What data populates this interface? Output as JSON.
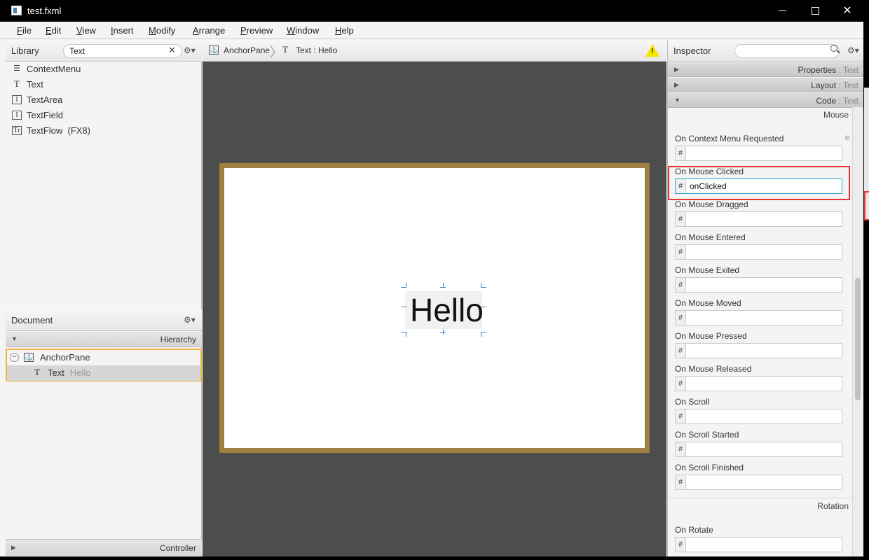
{
  "window": {
    "title": "test.fxml"
  },
  "menu": [
    {
      "label": "File",
      "u": "F",
      "rest": "ile"
    },
    {
      "label": "Edit",
      "u": "E",
      "rest": "dit"
    },
    {
      "label": "View",
      "u": "V",
      "rest": "iew"
    },
    {
      "label": "Insert",
      "u": "I",
      "rest": "nsert"
    },
    {
      "label": "Modify",
      "u": "M",
      "rest": "odify"
    },
    {
      "label": "Arrange",
      "u": "A",
      "rest": "rrange"
    },
    {
      "label": "Preview",
      "u": "P",
      "rest": "review"
    },
    {
      "label": "Window",
      "u": "W",
      "rest": "indow"
    },
    {
      "label": "Help",
      "u": "H",
      "rest": "elp"
    }
  ],
  "library": {
    "title": "Library",
    "search_value": "Text",
    "items": [
      {
        "label": "ContextMenu",
        "icon": "context-menu-icon"
      },
      {
        "label": "Text",
        "icon": "text-icon"
      },
      {
        "label": "TextArea",
        "icon": "textarea-icon"
      },
      {
        "label": "TextField",
        "icon": "textfield-icon"
      },
      {
        "label": "TextFlow  (FX8)",
        "icon": "textflow-icon"
      }
    ]
  },
  "document": {
    "title": "Document",
    "hierarchy_label": "Hierarchy",
    "tree": [
      {
        "label": "AnchorPane",
        "hint": ""
      },
      {
        "label": "Text",
        "hint": "Hello"
      }
    ],
    "controller_label": "Controller"
  },
  "breadcrumb": {
    "items": [
      "AnchorPane",
      "Text : Hello"
    ]
  },
  "canvas": {
    "text": "Hello"
  },
  "inspector": {
    "title": "Inspector",
    "sections": [
      {
        "name": "Properties",
        "sub": "Text",
        "expanded": false
      },
      {
        "name": "Layout",
        "sub": "Text",
        "expanded": false
      },
      {
        "name": "Code",
        "sub": "Text",
        "expanded": true
      }
    ],
    "group_mouse": "Mouse",
    "group_rotation": "Rotation",
    "fields": [
      {
        "label": "On Context Menu Requested",
        "value": ""
      },
      {
        "label": "On Mouse Clicked",
        "value": "onClicked"
      },
      {
        "label": "On Mouse Dragged",
        "value": ""
      },
      {
        "label": "On Mouse Entered",
        "value": ""
      },
      {
        "label": "On Mouse Exited",
        "value": ""
      },
      {
        "label": "On Mouse Moved",
        "value": ""
      },
      {
        "label": "On Mouse Pressed",
        "value": ""
      },
      {
        "label": "On Mouse Released",
        "value": ""
      },
      {
        "label": "On Scroll",
        "value": ""
      },
      {
        "label": "On Scroll Started",
        "value": ""
      },
      {
        "label": "On Scroll Finished",
        "value": ""
      }
    ],
    "rotation_fields": [
      {
        "label": "On Rotate",
        "value": ""
      }
    ],
    "hash_symbol": "#"
  },
  "colors": {
    "selection_border": "#f2b441",
    "canvas_frame": "#a08040",
    "focus_border": "#2aa0d0",
    "highlight": "#e53535",
    "workspace": "#4d4d4d"
  }
}
